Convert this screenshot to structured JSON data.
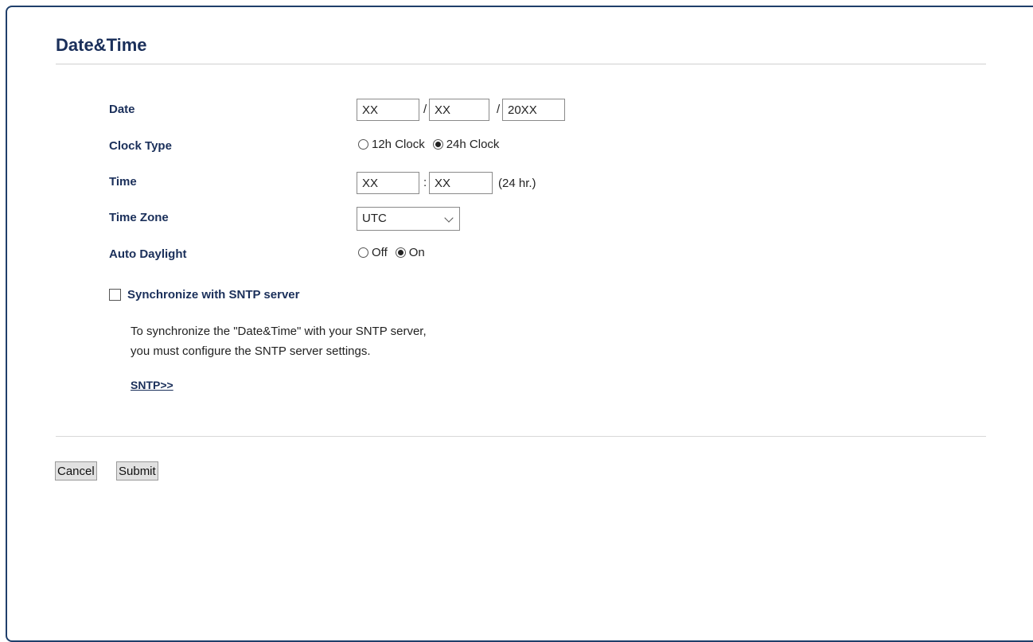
{
  "page": {
    "title": "Date&Time"
  },
  "form": {
    "date": {
      "label": "Date",
      "day": "XX",
      "month": "XX",
      "year": "20XX",
      "separator": "/"
    },
    "clock_type": {
      "label": "Clock Type",
      "options": [
        "12h Clock",
        "24h Clock"
      ],
      "selected": "24h Clock"
    },
    "time": {
      "label": "Time",
      "hour": "XX",
      "minute": "XX",
      "separator": ":",
      "suffix": "(24 hr.)"
    },
    "time_zone": {
      "label": "Time Zone",
      "selected": "UTC"
    },
    "auto_daylight": {
      "label": "Auto Daylight",
      "options": [
        "Off",
        "On"
      ],
      "selected": "On"
    },
    "sntp": {
      "checkbox_label": "Synchronize with SNTP server",
      "checked": false,
      "info_line1": "To synchronize the \"Date&Time\" with your SNTP server,",
      "info_line2": "you must configure the SNTP server settings.",
      "link_label": "SNTP>>"
    }
  },
  "buttons": {
    "cancel": "Cancel",
    "submit": "Submit"
  },
  "colors": {
    "heading": "#1a2f5a",
    "frame_border": "#1f3f6b",
    "button_bg": "#e1e1e1"
  }
}
